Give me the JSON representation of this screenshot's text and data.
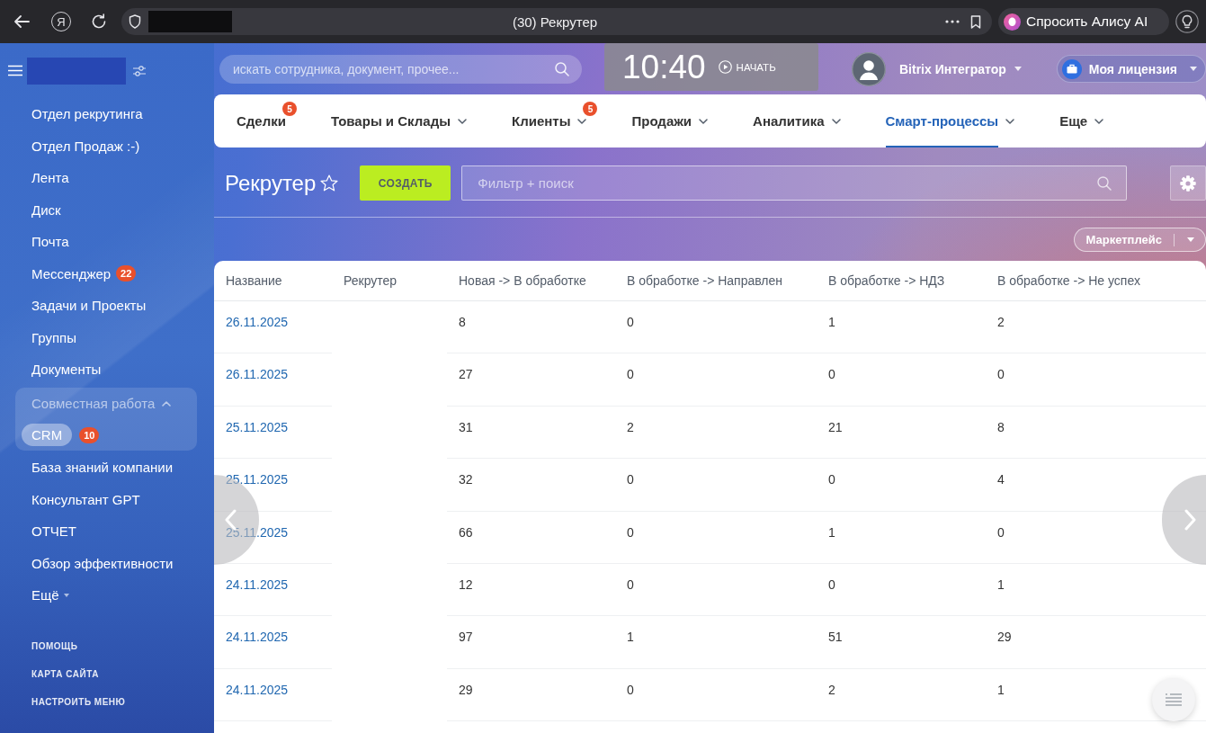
{
  "browser": {
    "home_button": "Я",
    "title": "(30) Рекрутер",
    "assistant_button": "Спросить Алису AI"
  },
  "sidebar": {
    "items": [
      {
        "kind": "link",
        "label": "Отдел рекрутинга",
        "selected": false
      },
      {
        "kind": "link",
        "label": "Отдел Продаж :-)",
        "selected": false
      },
      {
        "kind": "link",
        "label": "Лента",
        "selected": false
      },
      {
        "kind": "link",
        "label": "Диск",
        "selected": false
      },
      {
        "kind": "link",
        "label": "Почта",
        "selected": false
      },
      {
        "kind": "link",
        "label": "Мессенджер",
        "badge": "22",
        "selected": false
      },
      {
        "kind": "link",
        "label": "Задачи и Проекты",
        "selected": false
      },
      {
        "kind": "link",
        "label": "Группы",
        "selected": false
      },
      {
        "kind": "link",
        "label": "Документы",
        "selected": false
      },
      {
        "kind": "group",
        "label": "Совместная работа",
        "selected": false,
        "expanded": true,
        "children": [
          {
            "kind": "link",
            "label": "CRM",
            "badge": "10",
            "selected": true
          }
        ]
      },
      {
        "kind": "link",
        "label": "База знаний компании",
        "selected": false
      },
      {
        "kind": "link",
        "label": "Консультант GPT",
        "selected": false
      },
      {
        "kind": "link",
        "label": "ОТЧЕТ",
        "selected": false
      },
      {
        "kind": "link",
        "label": "Обзор эффективности",
        "selected": false
      },
      {
        "kind": "more",
        "label": "Ещё",
        "selected": false
      }
    ],
    "footer_links": [
      "ПОМОЩЬ",
      "КАРТА САЙТА",
      "НАСТРОИТЬ МЕНЮ"
    ]
  },
  "header": {
    "search": {
      "placeholder": "искать сотрудника, документ, прочее..."
    },
    "clock": {
      "time": "10:40",
      "action": "НАЧАТЬ"
    },
    "user": {
      "name": "Bitrix Интегратор"
    },
    "license_button": "Моя лицензия"
  },
  "nav": {
    "tabs": [
      {
        "label": "Сделки",
        "badge": "5",
        "has_menu": false,
        "selected": false
      },
      {
        "label": "Товары и Склады",
        "has_menu": true,
        "selected": false
      },
      {
        "label": "Клиенты",
        "badge": "5",
        "has_menu": true,
        "selected": false
      },
      {
        "label": "Продажи",
        "has_menu": true,
        "selected": false
      },
      {
        "label": "Аналитика",
        "has_menu": true,
        "selected": false
      },
      {
        "label": "Смарт-процессы",
        "has_menu": true,
        "selected": true
      },
      {
        "label": "Еще",
        "has_menu": true,
        "selected": false
      }
    ]
  },
  "toolbar": {
    "title": "Рекрутер",
    "favorite": false,
    "create_button": "СОЗДАТЬ",
    "filter": {
      "placeholder": "Фильтр + поиск"
    },
    "marketplace_button": "Маркетплейс"
  },
  "table": {
    "columns": [
      "Название",
      "Рекрутер",
      "Новая -> В обработке",
      "В обработке -> Направлен",
      "В обработке -> НДЗ",
      "В обработке -> Не успех"
    ],
    "rows": [
      {
        "name": "26.11.2025",
        "counts": [
          "8",
          "0",
          "1",
          "2"
        ]
      },
      {
        "name": "26.11.2025",
        "counts": [
          "27",
          "0",
          "0",
          "0"
        ]
      },
      {
        "name": "25.11.2025",
        "counts": [
          "31",
          "2",
          "21",
          "8"
        ]
      },
      {
        "name": "25.11.2025",
        "counts": [
          "32",
          "0",
          "0",
          "4"
        ]
      },
      {
        "name": "25.11.2025",
        "counts": [
          "66",
          "0",
          "1",
          "0"
        ]
      },
      {
        "name": "24.11.2025",
        "counts": [
          "12",
          "0",
          "0",
          "1"
        ]
      },
      {
        "name": "24.11.2025",
        "counts": [
          "97",
          "1",
          "51",
          "29"
        ]
      },
      {
        "name": "24.11.2025",
        "counts": [
          "29",
          "0",
          "2",
          "1"
        ]
      }
    ]
  }
}
